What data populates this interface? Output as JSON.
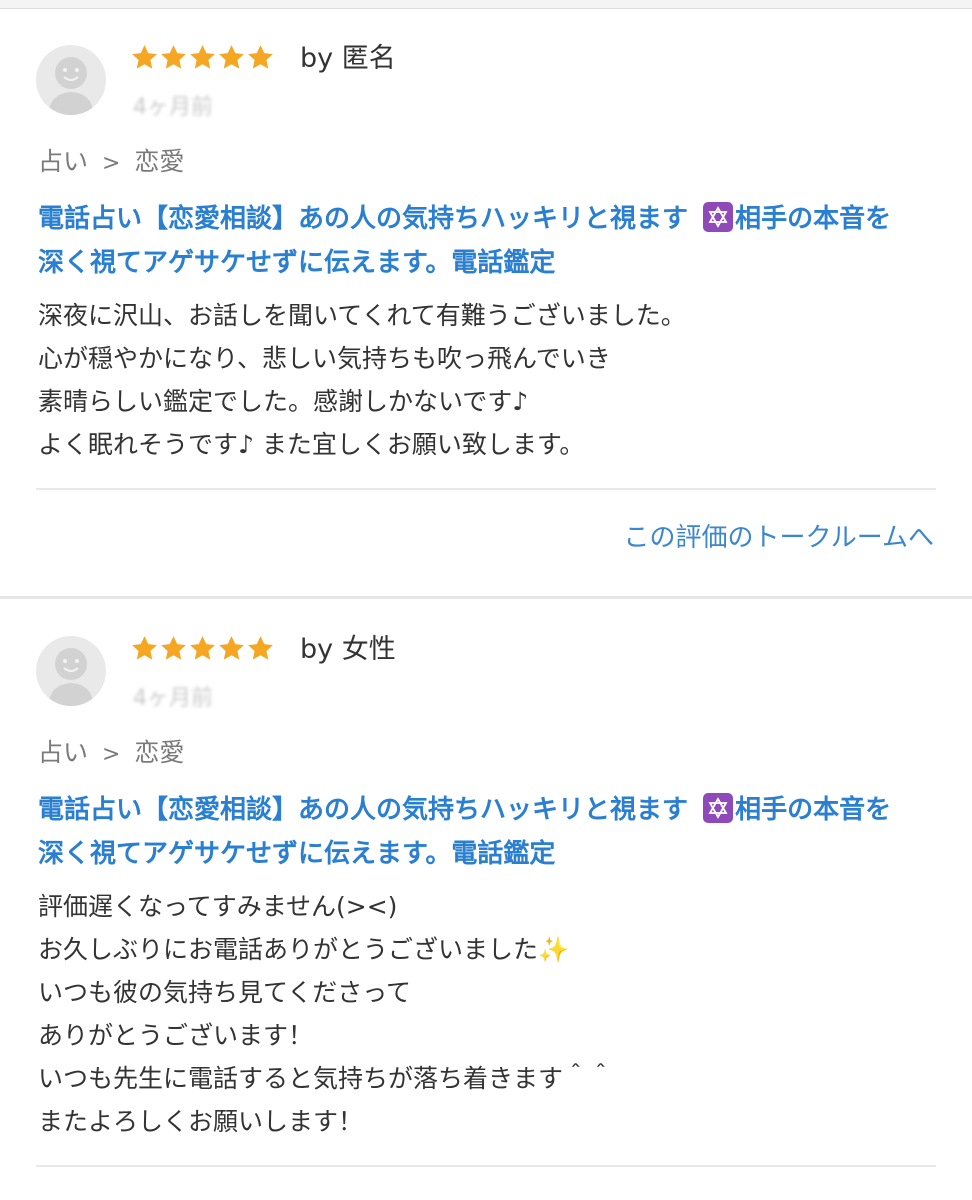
{
  "reviews": [
    {
      "rating": 5,
      "by_label": "by 匿名",
      "date": "4ヶ月前",
      "category": {
        "parent": "占い",
        "separator": ">",
        "child": "恋愛"
      },
      "service_title_part1": "電話占い【恋愛相談】あの人の気持ちハッキリと視ます ",
      "service_title_part2": "相手の本音を",
      "service_title_line2": "深く視てアゲサケせずに伝えます。電話鑑定",
      "body_lines": [
        "深夜に沢山、お話しを聞いてくれて有難うございました。",
        "心が穏やかになり、悲しい気持ちも吹っ飛んでいき",
        "素晴らしい鑑定でした。感謝しかないです♪",
        "よく眠れそうです♪ また宜しくお願い致します。"
      ],
      "talk_link": "この評価のトークルームへ"
    },
    {
      "rating": 5,
      "by_label": "by 女性",
      "date": "4ヶ月前",
      "category": {
        "parent": "占い",
        "separator": ">",
        "child": "恋愛"
      },
      "service_title_part1": "電話占い【恋愛相談】あの人の気持ちハッキリと視ます ",
      "service_title_part2": "相手の本音を",
      "service_title_line2": "深く視てアゲサケせずに伝えます。電話鑑定",
      "body_lines": [
        "評価遅くなってすみません(><)",
        "お久しぶりにお電話ありがとうございました",
        "いつも彼の気持ち見てくださって",
        "ありがとうございます！",
        "いつも先生に電話すると気持ちが落ち着きます＾＾",
        "またよろしくお願いします！"
      ],
      "sparkle": "✨"
    }
  ],
  "colors": {
    "star": "#f5a623",
    "title_link": "#2a7fd1",
    "talk_link": "#3a86cf",
    "emoji_bg": "#8e4ab8"
  },
  "icons": {
    "avatar": "default-user-avatar-icon",
    "star": "star-icon",
    "emoji": "star-of-david-emoji-icon"
  }
}
